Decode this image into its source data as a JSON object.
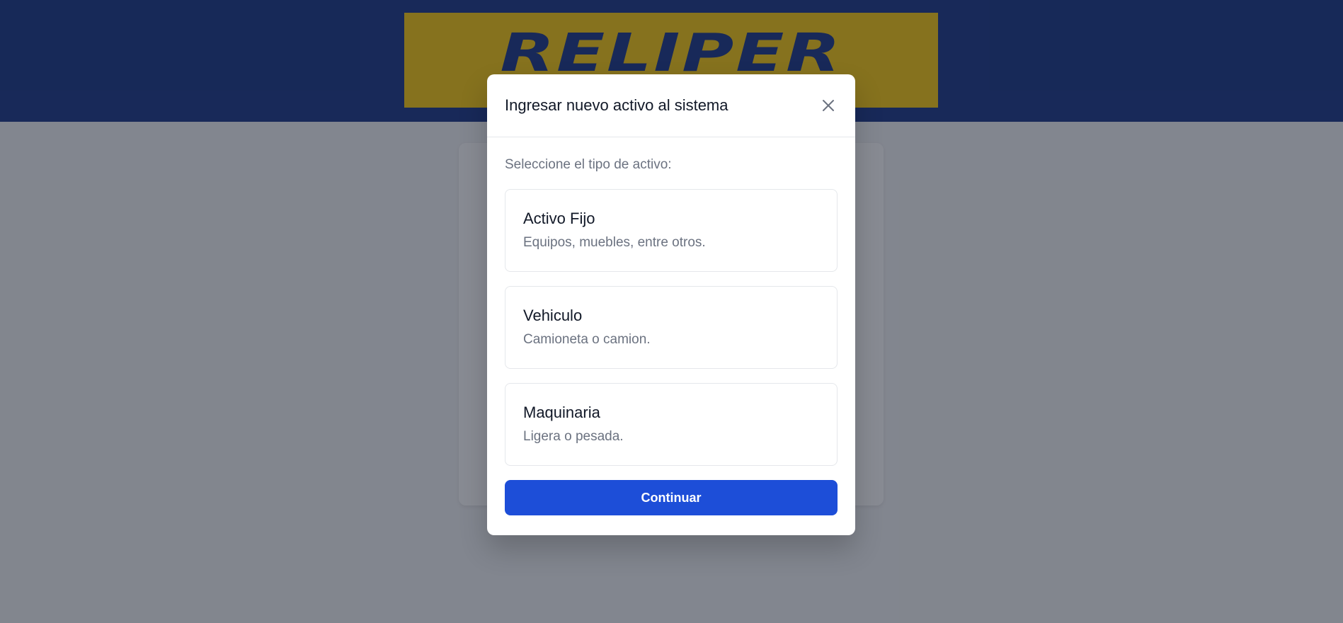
{
  "brand": {
    "logo_text": "RELIPER",
    "header_color": "#1e3a8a",
    "logo_bg_color": "#facc15"
  },
  "modal": {
    "title": "Ingresar nuevo activo al sistema",
    "close_icon": "close-icon",
    "prompt": "Seleccione el tipo de activo:",
    "options": [
      {
        "title": "Activo Fijo",
        "description": "Equipos, muebles, entre otros."
      },
      {
        "title": "Vehiculo",
        "description": "Camioneta o camion."
      },
      {
        "title": "Maquinaria",
        "description": "Ligera o pesada."
      }
    ],
    "continue_label": "Continuar",
    "accent_color": "#1d4ed8"
  }
}
